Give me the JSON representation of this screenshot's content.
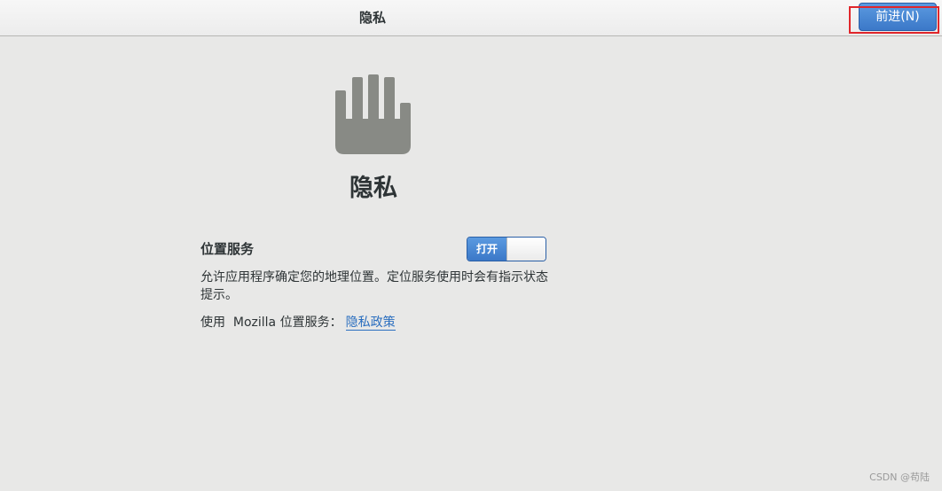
{
  "header": {
    "title": "隐私",
    "next_button_label": "前进(N)"
  },
  "main": {
    "icon": "hand-stop-icon",
    "title": "隐私",
    "location_service": {
      "label": "位置服务",
      "toggle_label": "打开",
      "enabled": true,
      "description": "允许应用程序确定您的地理位置。定位服务使用时会有指示状态提示。",
      "mozilla_text": "使用  Mozilla 位置服务：",
      "privacy_link": "隐私政策"
    }
  },
  "watermark": "CSDN @苟陆",
  "colors": {
    "accent": "#3b78c8",
    "highlight": "#e0262b",
    "icon": "#888a85",
    "link": "#2a6ebf"
  }
}
